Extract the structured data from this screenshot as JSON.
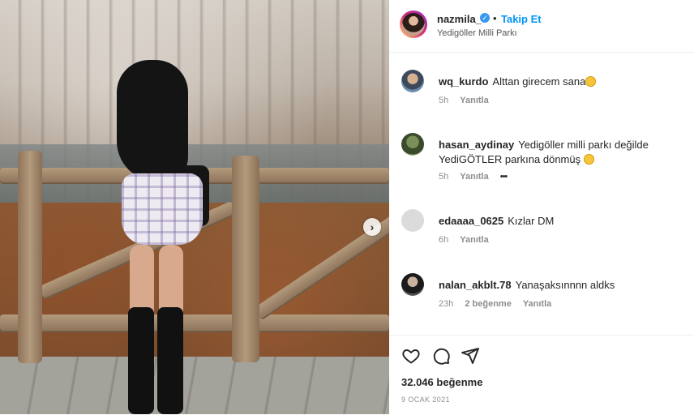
{
  "post": {
    "username": "nazmila_",
    "verified_symbol": "✓",
    "separator": "•",
    "follow_label": "Takip Et",
    "location": "Yedigöller Milli Parkı"
  },
  "comments": [
    {
      "username": "wq_kurdo",
      "text": "Alttan girecem sana",
      "time": "5h",
      "likes": "",
      "reply_label": "Yanıtla"
    },
    {
      "username": "hasan_aydinay",
      "text": "Yedigöller milli parkı değilde YediGÖTLER parkına dönmüş",
      "time": "5h",
      "likes": "",
      "reply_label": "Yanıtla",
      "more": "•••"
    },
    {
      "username": "edaaaa_0625",
      "text": "Kızlar DM",
      "time": "6h",
      "likes": "",
      "reply_label": "Yanıtla"
    },
    {
      "username": "nalan_akblt.78",
      "text": "Yanaşaksınnnn aldks",
      "time": "23h",
      "likes": "2 beğenme",
      "reply_label": "Yanıtla"
    }
  ],
  "footer": {
    "likes_count": "32.046 beğenme",
    "date": "9 OCAK 2021"
  },
  "icons": {
    "like": "heart-icon",
    "comment": "comment-icon",
    "share": "share-icon",
    "next": "chevron-right-icon"
  },
  "colors": {
    "follow": "#0095f6",
    "verified": "#3897f0",
    "muted": "#8e8e8e"
  }
}
